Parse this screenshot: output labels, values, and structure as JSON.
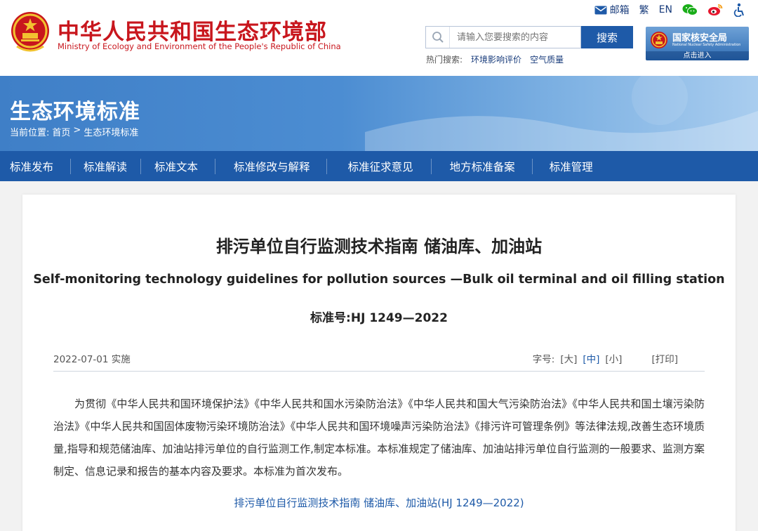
{
  "site": {
    "title_cn": "中华人民共和国生态环境部",
    "title_en": "Ministry of Ecology and Environment of the People's Republic of China"
  },
  "toolbar": {
    "mail_label": "邮箱",
    "traditional_label": "繁",
    "english_label": "EN"
  },
  "search": {
    "placeholder": "请输入您要搜索的内容",
    "button_label": "搜索",
    "hot_label": "热门搜索:",
    "hot_links": [
      "环境影响评价",
      "空气质量"
    ]
  },
  "nnsa": {
    "name_cn": "国家核安全局",
    "name_en": "National Nuclear Safety Administration",
    "enter_label": "点击进入"
  },
  "banner": {
    "title": "生态环境标准",
    "crumb_prefix": "当前位置:",
    "crumb_home": "首页",
    "crumb_sep": ">",
    "crumb_current": "生态环境标准"
  },
  "nav": {
    "items": [
      "标准发布",
      "标准解读",
      "标准文本",
      "标准修改与解释",
      "标准征求意见",
      "地方标准备案",
      "标准管理"
    ]
  },
  "doc": {
    "title_cn": "排污单位自行监测技术指南 储油库、加油站",
    "title_en": "Self-monitoring technology guidelines for pollution sources —Bulk oil terminal and oil filling station",
    "standard_no": "标准号:HJ 1249—2022",
    "date": "2022-07-01 实施",
    "font_size_label": "字号:",
    "font_large": "[大]",
    "font_medium": "[中]",
    "font_small": "[小]",
    "print_label": "[打印]",
    "body": "为贯彻《中华人民共和国环境保护法》《中华人民共和国水污染防治法》《中华人民共和国大气污染防治法》《中华人民共和国土壤污染防治法》《中华人民共和国固体废物污染环境防治法》《中华人民共和国环境噪声污染防治法》《排污许可管理条例》等法律法规,改善生态环境质量,指导和规范储油库、加油站排污单位的自行监测工作,制定本标准。本标准规定了储油库、加油站排污单位自行监测的一般要求、监测方案制定、信息记录和报告的基本内容及要求。本标准为首次发布。",
    "link_text": "排污单位自行监测技术指南 储油库、加油站(HJ 1249—2022)"
  },
  "colors": {
    "brand_red": "#c8161d",
    "primary_blue": "#1e5aa8"
  }
}
